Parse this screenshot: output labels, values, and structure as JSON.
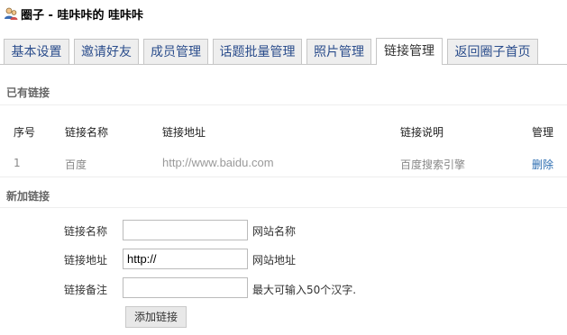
{
  "header": {
    "title": "圈子 - 哇咔咔的 哇咔咔",
    "icon": "group-people-icon"
  },
  "tabs": [
    {
      "label": "基本设置",
      "active": false
    },
    {
      "label": "邀请好友",
      "active": false
    },
    {
      "label": "成员管理",
      "active": false
    },
    {
      "label": "话题批量管理",
      "active": false
    },
    {
      "label": "照片管理",
      "active": false
    },
    {
      "label": "链接管理",
      "active": true
    },
    {
      "label": "返回圈子首页",
      "active": false
    }
  ],
  "existing": {
    "heading": "已有链接",
    "columns": [
      "序号",
      "链接名称",
      "链接地址",
      "链接说明",
      "管理"
    ],
    "rows": [
      {
        "index": "1",
        "name": "百度",
        "url": "http://www.baidu.com",
        "description": "百度搜索引擎",
        "action": "删除"
      }
    ]
  },
  "new_link": {
    "heading": "新加链接",
    "fields": [
      {
        "label": "链接名称",
        "value": "",
        "hint": "网站名称"
      },
      {
        "label": "链接地址",
        "value": "http://",
        "hint": "网站地址"
      },
      {
        "label": "链接备注",
        "value": "",
        "hint": "最大可输入50个汉字."
      }
    ],
    "submit_label": "添加链接"
  },
  "colors": {
    "tab_text": "#2b4d8c",
    "link": "#2b6cb0",
    "section_label": "#666666"
  }
}
